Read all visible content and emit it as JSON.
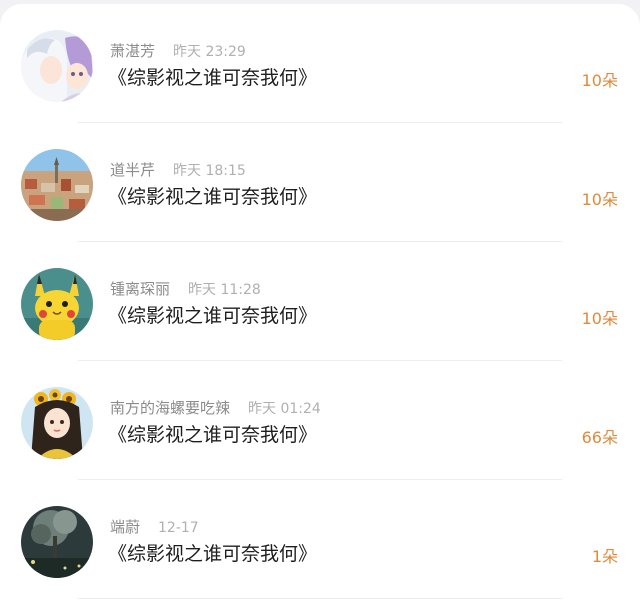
{
  "gift_list": [
    {
      "name": "萧湛芳",
      "time": "昨天 23:29",
      "title": "《综影视之谁可奈我何》",
      "amount": "10朵",
      "avatar_icon": "anime-girls-avatar-icon"
    },
    {
      "name": "道半芹",
      "time": "昨天 18:15",
      "title": "《综影视之谁可奈我何》",
      "amount": "10朵",
      "avatar_icon": "city-view-avatar-icon"
    },
    {
      "name": "锺离琛丽",
      "time": "昨天 11:28",
      "title": "《综影视之谁可奈我何》",
      "amount": "10朵",
      "avatar_icon": "pikachu-avatar-icon"
    },
    {
      "name": "南方的海螺要吃辣",
      "time": "昨天 01:24",
      "title": "《综影视之谁可奈我何》",
      "amount": "66朵",
      "avatar_icon": "sunflower-girl-avatar-icon"
    },
    {
      "name": "端蔚",
      "time": "12-17",
      "title": "《综影视之谁可奈我何》",
      "amount": "1朵",
      "avatar_icon": "night-tree-avatar-icon"
    }
  ],
  "colors": {
    "amount": "#e08a3c",
    "name": "#8c8c8c",
    "time": "#b0b0b0",
    "title": "#1e1e1e"
  }
}
